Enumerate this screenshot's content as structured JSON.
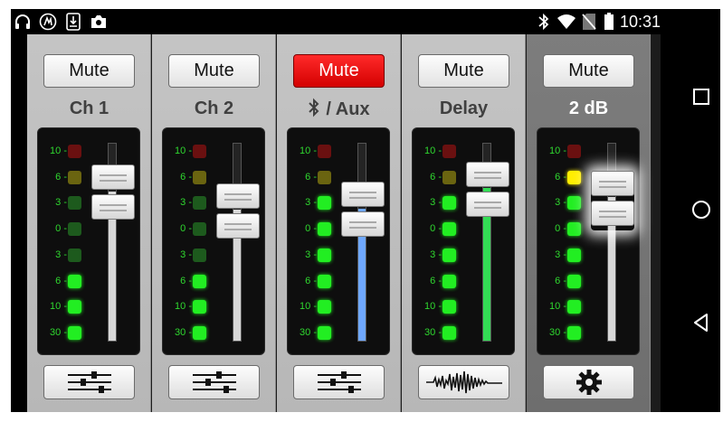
{
  "status_bar": {
    "left_icons": [
      "headphones-icon",
      "app-logo-icon",
      "download-icon",
      "camera-icon"
    ],
    "right_icons": [
      "bluetooth-icon",
      "wifi-icon",
      "no-sim-icon",
      "battery-icon"
    ],
    "time": "10:31"
  },
  "nav_bar": {
    "icons": [
      "recent-apps-icon",
      "home-icon",
      "back-icon"
    ]
  },
  "meter_labels": [
    "10",
    "6",
    "3",
    "0",
    "3",
    "6",
    "10",
    "30"
  ],
  "colors": {
    "led_green": "#22ee22",
    "led_dark_green": "#1d5a1d",
    "led_dark_yellow": "#6a6410",
    "led_yellow": "#ffee00",
    "led_dark_red": "#6a1010",
    "mute_active": "#ee0000",
    "aux_fill": "#6fa8ff",
    "delay_fill": "#33dd55"
  },
  "channels": [
    {
      "mute_label": "Mute",
      "mute_active": false,
      "label": "Ch 1",
      "bluetooth_icon": false,
      "leds": [
        "dark_red",
        "dark_yellow",
        "dark_green",
        "dark_green",
        "dark_green",
        "green",
        "green",
        "green"
      ],
      "fader_level": 0.76,
      "fill": "",
      "bottom_icon": "eq-sliders-icon"
    },
    {
      "mute_label": "Mute",
      "mute_active": false,
      "label": "Ch 2",
      "bluetooth_icon": false,
      "leds": [
        "dark_red",
        "dark_yellow",
        "dark_green",
        "dark_green",
        "dark_green",
        "green",
        "green",
        "green"
      ],
      "fader_level": 0.63,
      "fill": "",
      "bottom_icon": "eq-sliders-icon"
    },
    {
      "mute_label": "Mute",
      "mute_active": true,
      "label": "/ Aux",
      "bluetooth_icon": true,
      "leds": [
        "dark_red",
        "dark_yellow",
        "green",
        "green",
        "green",
        "green",
        "green",
        "green"
      ],
      "fader_level": 0.64,
      "fill": "aux",
      "bottom_icon": "eq-sliders-icon"
    },
    {
      "mute_label": "Mute",
      "mute_active": false,
      "label": "Delay",
      "bluetooth_icon": false,
      "leds": [
        "dark_red",
        "dark_yellow",
        "green",
        "green",
        "green",
        "green",
        "green",
        "green"
      ],
      "fader_level": 0.78,
      "fill": "delay",
      "bottom_icon": "waveform-icon"
    },
    {
      "mute_label": "Mute",
      "mute_active": false,
      "label": "2  dB",
      "bluetooth_icon": false,
      "leds": [
        "dark_red",
        "yellow",
        "green",
        "green",
        "green",
        "green",
        "green",
        "green"
      ],
      "fader_level": 0.72,
      "fill": "",
      "bottom_icon": "gear-icon"
    }
  ]
}
